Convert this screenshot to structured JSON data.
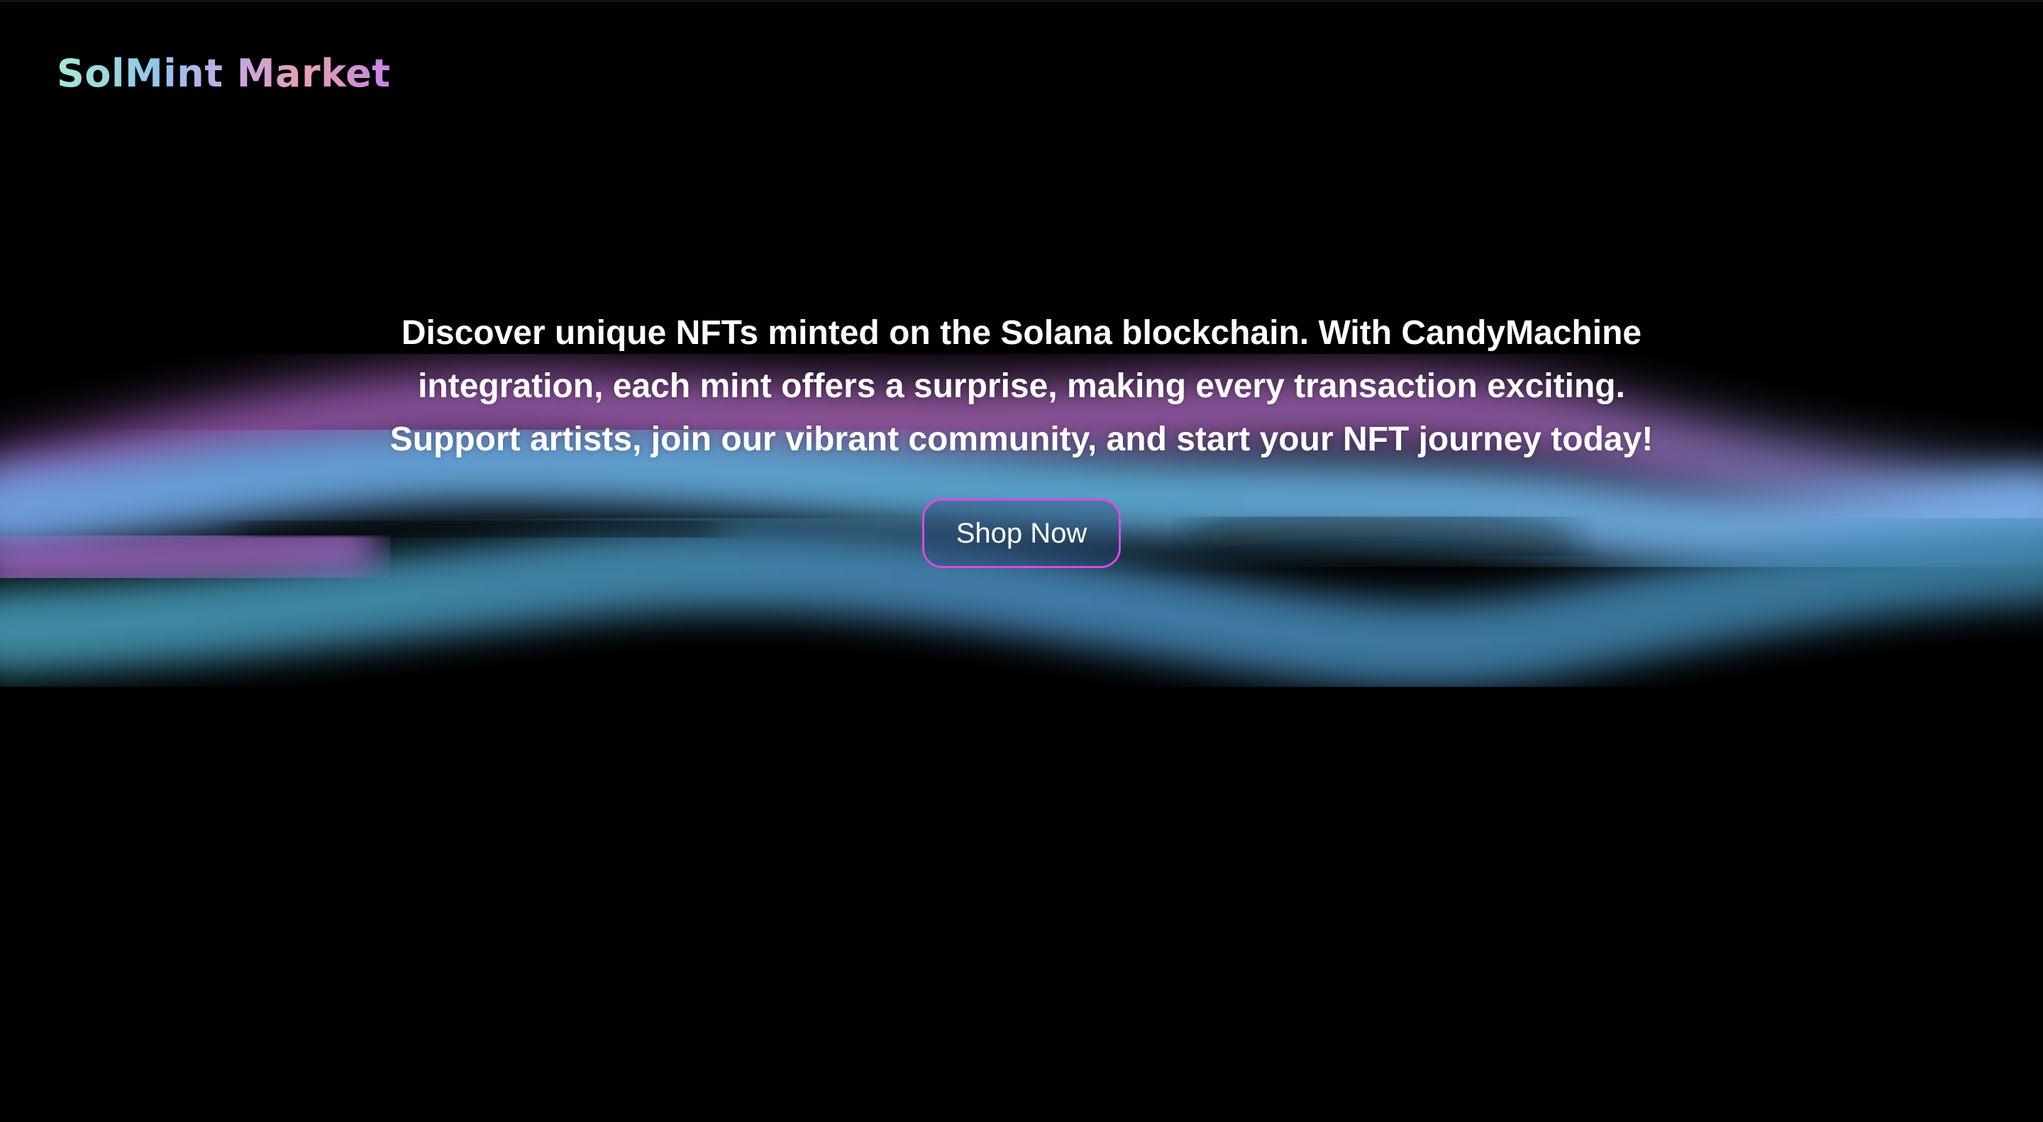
{
  "brand": {
    "logo_text": "SolMint Market"
  },
  "hero": {
    "description": "Discover unique NFTs minted on the Solana blockchain. With CandyMachine integration, each mint offers a surprise, making every transaction exciting. Support artists, join our vibrant community, and start your NFT journey today!",
    "cta_label": "Shop Now"
  },
  "colors": {
    "background": "#000000",
    "cta_border": "#d84be6",
    "wave_blue": "#6fa8e8",
    "wave_teal": "#4fb3c8",
    "wave_pink": "#d07ae0",
    "text": "#ffffff"
  }
}
